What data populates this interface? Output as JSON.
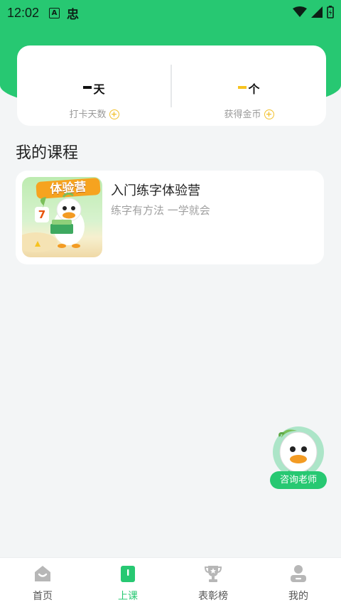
{
  "status_bar": {
    "time": "12:02",
    "glyph": "忠"
  },
  "stats": {
    "checkin": {
      "unit": "天",
      "label": "打卡天数"
    },
    "coins": {
      "unit": "个",
      "label": "获得金币"
    }
  },
  "section_title": "我的课程",
  "courses": [
    {
      "title": "入门练字体验营",
      "subtitle": "练字有方法 一学就会",
      "thumb_text": "体验营",
      "thumb_number": "7"
    }
  ],
  "consult_label": "咨询老师",
  "nav": [
    {
      "label": "首页",
      "icon": "home-icon"
    },
    {
      "label": "上课",
      "icon": "class-icon"
    },
    {
      "label": "表彰榜",
      "icon": "trophy-icon"
    },
    {
      "label": "我的",
      "icon": "profile-icon"
    }
  ],
  "colors": {
    "accent": "#27c872",
    "gold": "#f2c12e",
    "background": "#f3f5f6"
  }
}
